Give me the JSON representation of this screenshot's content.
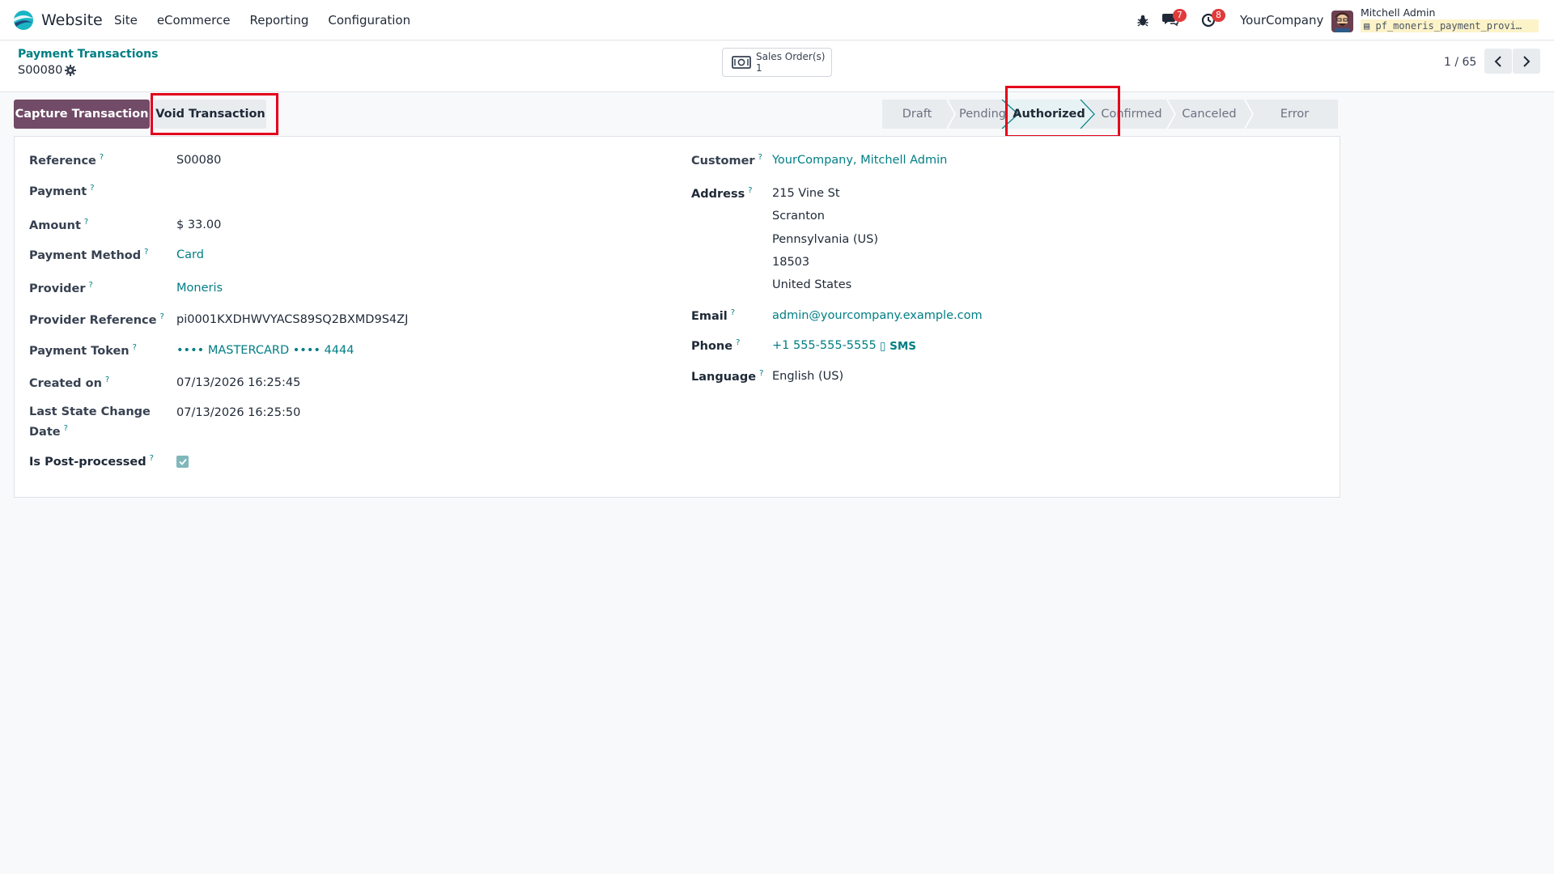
{
  "navbar": {
    "app_name": "Website",
    "menu": [
      "Site",
      "eCommerce",
      "Reporting",
      "Configuration"
    ],
    "messages_count": "7",
    "activities_count": "8",
    "company": "YourCompany",
    "user_name": "Mitchell Admin",
    "database": "pf_moneris_payment_provi…"
  },
  "breadcrumb": {
    "parent": "Payment Transactions",
    "current": "S00080"
  },
  "smart_button": {
    "label": "Sales Order(s)",
    "value": "1"
  },
  "pager": {
    "value": "1 / 65"
  },
  "actions": {
    "capture": "Capture Transaction",
    "void": "Void Transaction"
  },
  "statusbar": {
    "stages": [
      "Draft",
      "Pending",
      "Authorized",
      "Confirmed",
      "Canceled",
      "Error"
    ],
    "active": "Authorized"
  },
  "form": {
    "left": {
      "reference_label": "Reference",
      "reference": "S00080",
      "payment_label": "Payment",
      "payment": "",
      "amount_label": "Amount",
      "amount": "$ 33.00",
      "method_label": "Payment Method",
      "method": "Card",
      "provider_label": "Provider",
      "provider": "Moneris",
      "provider_ref_label": "Provider Reference",
      "provider_ref": "pi0001KXDHWVYACS89SQ2BXMD9S4ZJ",
      "token_label": "Payment Token",
      "token": "•••• MASTERCARD •••• 4444",
      "created_label": "Created on",
      "created": "07/13/2026 16:25:45",
      "last_change_label_1": "Last State Change",
      "last_change_label_2": "Date",
      "last_change": "07/13/2026 16:25:50",
      "post_processed_label": "Is Post-processed",
      "post_processed": true
    },
    "right": {
      "customer_label": "Customer",
      "customer": "YourCompany, Mitchell Admin",
      "address_label": "Address",
      "address": [
        "215 Vine St",
        "Scranton",
        "Pennsylvania (US)",
        "18503",
        "United States"
      ],
      "email_label": "Email",
      "email": "admin@yourcompany.example.com",
      "phone_label": "Phone",
      "phone": "+1 555-555-5555",
      "sms": "SMS",
      "language_label": "Language",
      "language": "English (US)"
    }
  },
  "colors": {
    "primary": "#714b67",
    "link": "#017e84",
    "highlight": "#e3001b",
    "badge": "#e03b3b"
  }
}
